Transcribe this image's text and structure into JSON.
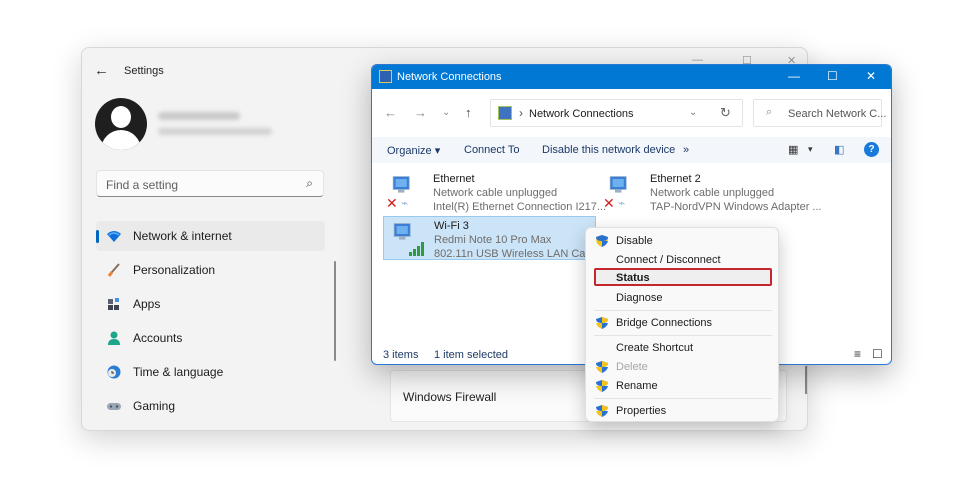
{
  "settings": {
    "title": "Settings",
    "search_placeholder": "Find a setting",
    "nav": [
      {
        "label": "Network & internet",
        "icon": "wifi-icon",
        "active": true
      },
      {
        "label": "Personalization",
        "icon": "brush-icon"
      },
      {
        "label": "Apps",
        "icon": "apps-icon"
      },
      {
        "label": "Accounts",
        "icon": "person-icon"
      },
      {
        "label": "Time & language",
        "icon": "globe-clock-icon"
      },
      {
        "label": "Gaming",
        "icon": "gamepad-icon"
      }
    ],
    "content_card": "Windows Firewall",
    "controls": {
      "minimize": "—",
      "maximize": "☐",
      "close": "✕"
    }
  },
  "network_window": {
    "title": "Network Connections",
    "controls": {
      "minimize": "—",
      "maximize": "☐",
      "close": "✕"
    },
    "nav": {
      "back": "←",
      "forward": "→",
      "recent": "⌄",
      "up": "↑"
    },
    "address": {
      "chevron": "›",
      "path": "Network Connections",
      "dropdown": "⌄",
      "refresh": "↻"
    },
    "search_placeholder": "Search Network C...",
    "commands": {
      "organize": "Organize ▾",
      "connect_to": "Connect To",
      "disable": "Disable this network device",
      "more": "»",
      "view": "▾"
    },
    "help": "?",
    "items": [
      {
        "name": "Ethernet",
        "status": "Network cable unplugged",
        "device": "Intel(R) Ethernet Connection I217...",
        "state": "disconnected"
      },
      {
        "name": "Ethernet 2",
        "status": "Network cable unplugged",
        "device": "TAP-NordVPN Windows Adapter ...",
        "state": "disconnected"
      },
      {
        "name": "Wi-Fi 3",
        "status": "Redmi Note 10 Pro Max",
        "device": "802.11n USB Wireless LAN Card #2",
        "state": "connected",
        "selected": true
      }
    ],
    "status_bar": {
      "count": "3 items",
      "selected": "1 item selected"
    }
  },
  "context_menu": {
    "items": [
      {
        "label": "Disable",
        "shield": true
      },
      {
        "label": "Connect / Disconnect"
      },
      {
        "label": "Status",
        "bold": true,
        "highlighted": true
      },
      {
        "label": "Diagnose"
      },
      {
        "label": "Bridge Connections",
        "shield": true
      },
      {
        "label": "Create Shortcut"
      },
      {
        "label": "Delete",
        "shield": true,
        "disabled": true
      },
      {
        "label": "Rename",
        "shield": true
      },
      {
        "label": "Properties",
        "shield": true
      }
    ],
    "highlight_color": "#c4262e"
  },
  "colors": {
    "accent": "#0078d4",
    "selection": "#cce4f7"
  }
}
